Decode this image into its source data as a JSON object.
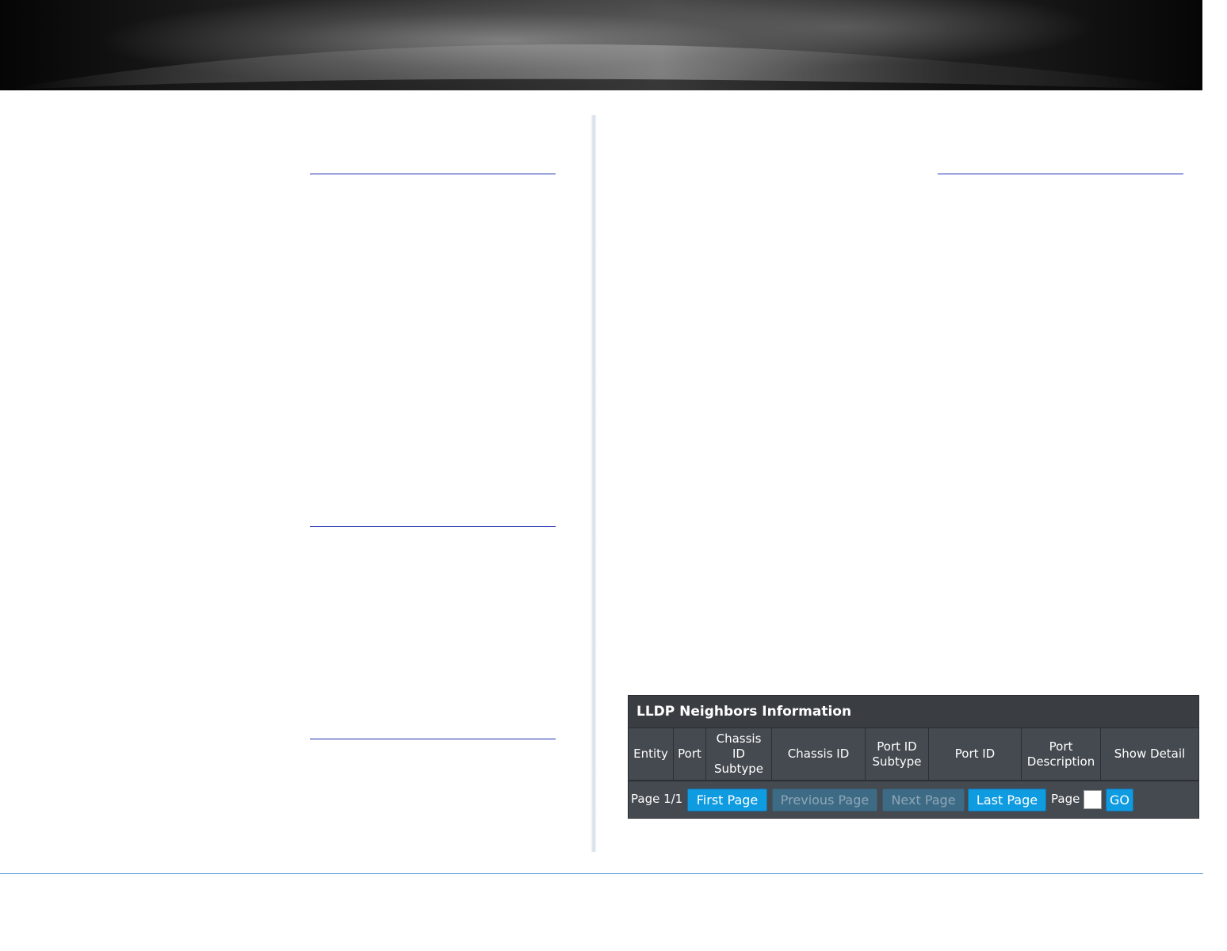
{
  "lldp": {
    "title": "LLDP Neighbors Information",
    "columns": [
      "Entity",
      "Port",
      "Chassis ID Subtype",
      "Chassis ID",
      "Port ID Subtype",
      "Port ID",
      "Port Description",
      "Show Detail"
    ],
    "pagination": {
      "page_status": "Page 1/1",
      "first_label": "First Page",
      "previous_label": "Previous Page",
      "next_label": "Next Page",
      "last_label": "Last Page",
      "page_label": "Page",
      "page_input_value": "",
      "go_label": "GO"
    }
  },
  "colors": {
    "accent_button": "#0f9be0",
    "panel_bg": "#454a50",
    "rule": "#1f2fb0",
    "footer_line": "#4a8fd6"
  }
}
